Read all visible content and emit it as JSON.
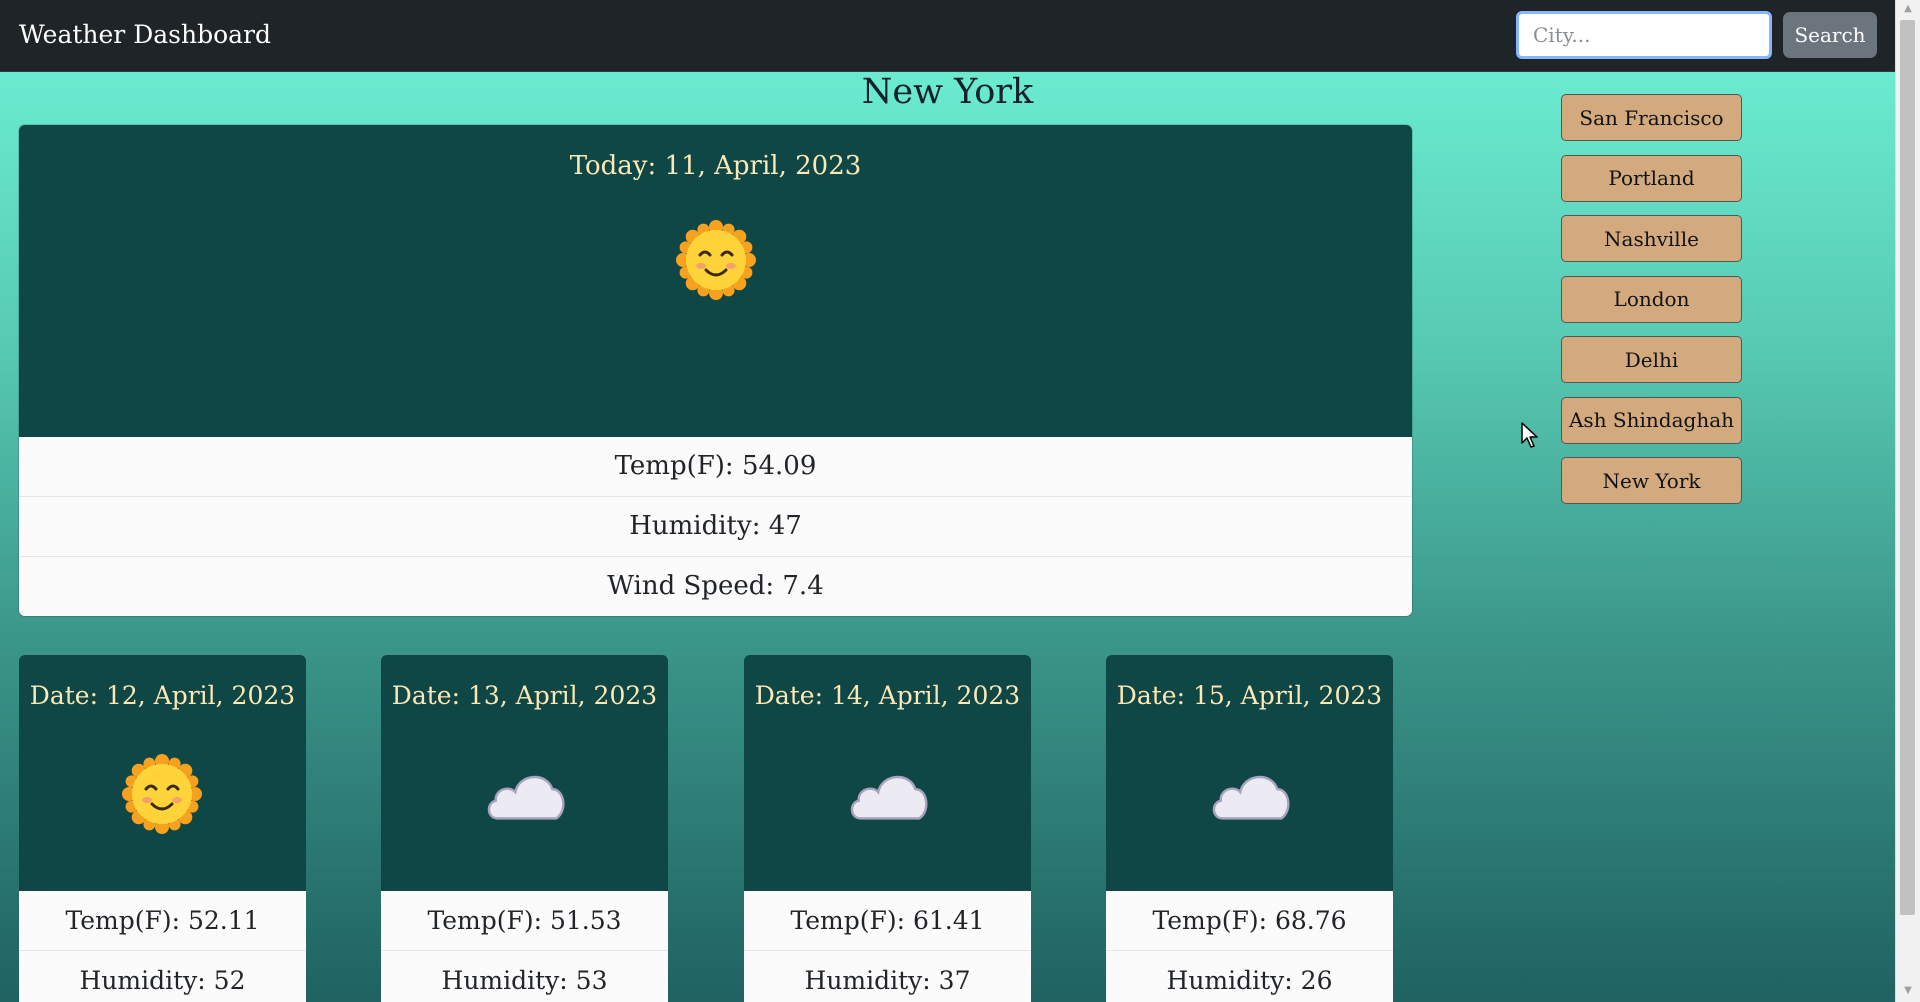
{
  "navbar": {
    "title": "Weather Dashboard",
    "search_placeholder": "City...",
    "search_label": "Search"
  },
  "current": {
    "city": "New York",
    "date": "Today: 11, April, 2023",
    "icon": "sun-face-icon",
    "temp": "Temp(F): 54.09",
    "humidity": "Humidity: 47",
    "wind": "Wind Speed: 7.4"
  },
  "history": [
    "San Francisco",
    "Portland",
    "Nashville",
    "London",
    "Delhi",
    "Ash Shindaghah",
    "New York"
  ],
  "forecast": [
    {
      "date": "Date: 12, April, 2023",
      "icon": "sun-face-icon",
      "temp": "Temp(F): 52.11",
      "humidity": "Humidity: 52"
    },
    {
      "date": "Date: 13, April, 2023",
      "icon": "cloud-icon",
      "temp": "Temp(F): 51.53",
      "humidity": "Humidity: 53"
    },
    {
      "date": "Date: 14, April, 2023",
      "icon": "cloud-icon",
      "temp": "Temp(F): 61.41",
      "humidity": "Humidity: 37"
    },
    {
      "date": "Date: 15, April, 2023",
      "icon": "cloud-icon",
      "temp": "Temp(F): 68.76",
      "humidity": "Humidity: 26"
    }
  ],
  "colors": {
    "card_dark": "#0f4646",
    "card_text": "#fbe8b4",
    "history_button": "#d2aa7e",
    "navbar": "#1e2427"
  }
}
